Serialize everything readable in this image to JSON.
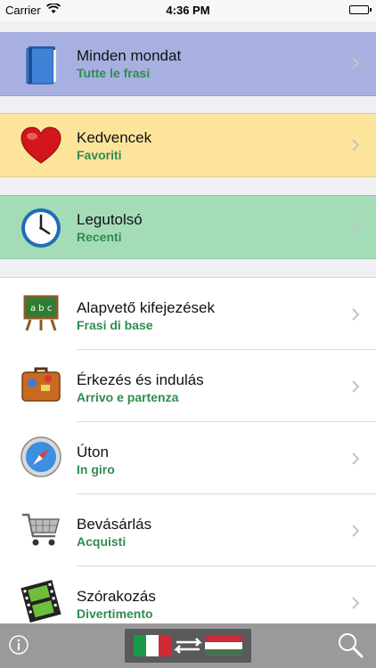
{
  "status_bar": {
    "carrier": "Carrier",
    "time": "4:36 PM"
  },
  "top_rows": [
    {
      "title": "Minden mondat",
      "subtitle": "Tutte le frasi",
      "icon": "book-icon"
    },
    {
      "title": "Kedvencek",
      "subtitle": "Favoriti",
      "icon": "heart-icon"
    },
    {
      "title": "Legutolsó",
      "subtitle": "Recenti",
      "icon": "clock-icon"
    }
  ],
  "categories": [
    {
      "title": "Alapvető kifejezések",
      "subtitle": "Frasi di base",
      "icon": "blackboard-icon"
    },
    {
      "title": "Érkezés és indulás",
      "subtitle": "Arrivo e partenza",
      "icon": "suitcase-icon"
    },
    {
      "title": "Úton",
      "subtitle": "In giro",
      "icon": "compass-icon"
    },
    {
      "title": "Bevásárlás",
      "subtitle": "Acquisti",
      "icon": "shopping-cart-icon"
    },
    {
      "title": "Szórakozás",
      "subtitle": "Divertimento",
      "icon": "film-strip-icon"
    }
  ],
  "colors": {
    "row_all": "#a7b0e0",
    "row_favorites": "#fce59b",
    "row_recent": "#a4dcb8",
    "subtitle_green": "#2f8c4f"
  },
  "bottom_bar": {
    "info_icon": "info-icon",
    "language_switch_icon": "language-swap-icon",
    "search_icon": "magnifier-icon"
  }
}
